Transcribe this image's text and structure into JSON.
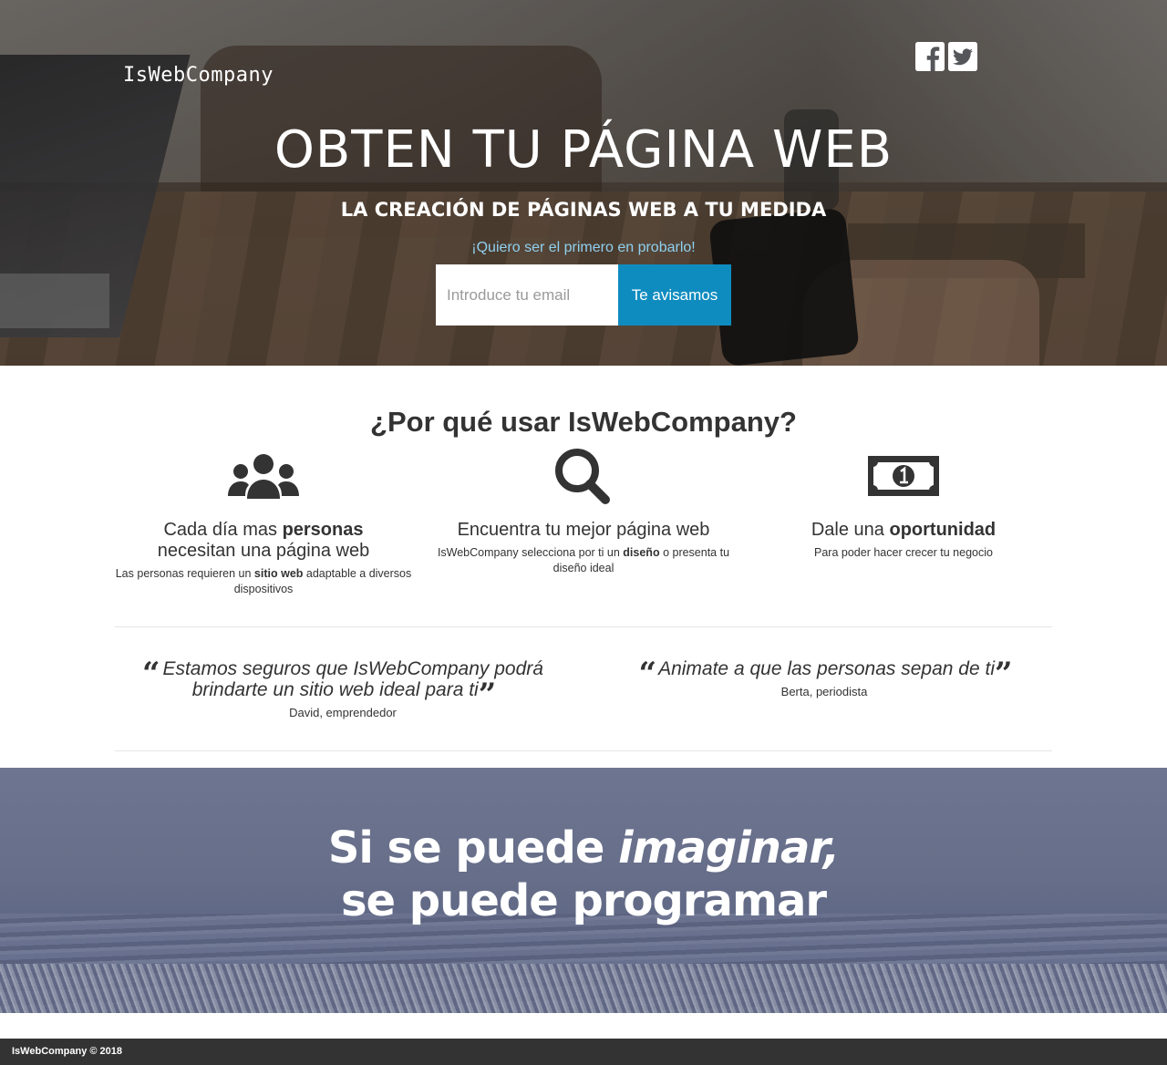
{
  "brand": {
    "logo_text": "IsWebCompany"
  },
  "social": {
    "facebook_icon": "facebook-icon",
    "twitter_icon": "twitter-icon"
  },
  "hero": {
    "title": "OBTEN TU PÁGINA WEB",
    "subtitle": "LA CREACIÓN DE PÁGINAS WEB A TU MEDIDA",
    "cta_text": "¡Quiero ser el primero en probarlo!",
    "email_placeholder": "Introduce tu email",
    "email_value": "",
    "submit_label": "Te avisamos"
  },
  "why": {
    "title": "¿Por qué usar IsWebCompany?",
    "features": [
      {
        "icon": "users-icon",
        "heading_pre": "Cada día mas ",
        "heading_bold": "personas",
        "heading_post": " necesitan una página web",
        "text_pre": "Las personas requieren un ",
        "text_bold": "sitio web",
        "text_post": " adaptable a diversos dispositivos"
      },
      {
        "icon": "search-icon",
        "heading_pre": "Encuentra tu mejor página web",
        "heading_bold": "",
        "heading_post": "",
        "text_pre": "IsWebCompany selecciona por ti un ",
        "text_bold": "diseño",
        "text_post": " o presenta tu diseño ideal"
      },
      {
        "icon": "money-icon",
        "heading_pre": "Dale una ",
        "heading_bold": "oportunidad",
        "heading_post": "",
        "text_pre": "Para poder hacer crecer tu negocio",
        "text_bold": "",
        "text_post": ""
      }
    ]
  },
  "testimonials": [
    {
      "quote": "Estamos seguros que IsWebCompany podrá brindarte un sitio web ideal para ti",
      "author": "David, emprendedor"
    },
    {
      "quote": "Animate a que las personas sepan de ti",
      "author": "Berta, periodista"
    }
  ],
  "banner": {
    "line1_pre": "Si se puede ",
    "line1_italic": "imaginar,",
    "line2": "se puede programar"
  },
  "footer": {
    "copyright": "IsWebCompany © 2018"
  }
}
